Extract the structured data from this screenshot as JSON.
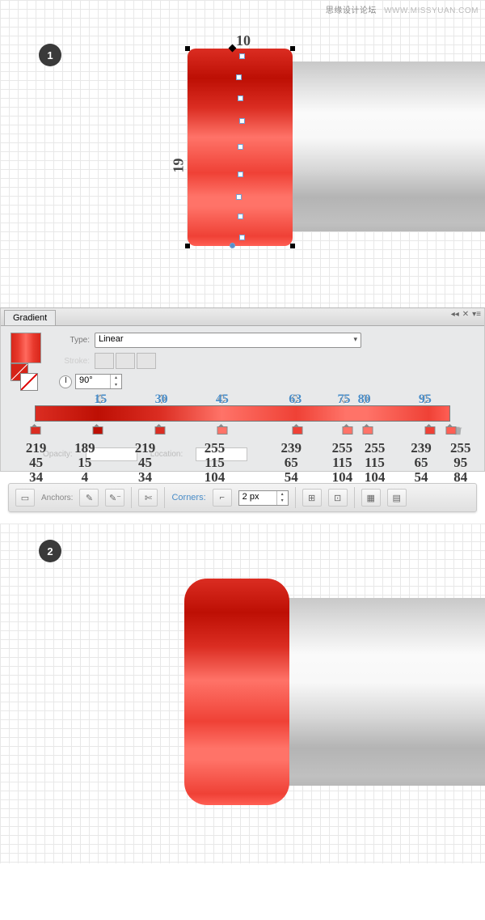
{
  "watermark": {
    "chinese": "思缘设计论坛",
    "url": "WWW.MISSYUAN.COM"
  },
  "step1": {
    "num": "1",
    "dim_w": "10",
    "dim_h": "19"
  },
  "step2": {
    "num": "2"
  },
  "panel": {
    "title": "Gradient",
    "type_label": "Type:",
    "type_value": "Linear",
    "stroke_label": "Stroke:",
    "angle_icon": "angle",
    "angle_value": "90°",
    "opacity_label": "Opacity:",
    "location_label": "Location:"
  },
  "gradient": {
    "positions": [
      "15",
      "30",
      "45",
      "63",
      "75",
      "80",
      "95"
    ],
    "stops": [
      {
        "pos": 0,
        "r": "219",
        "g": "45",
        "b": "34"
      },
      {
        "pos": 15,
        "r": "189",
        "g": "15",
        "b": "4"
      },
      {
        "pos": 30,
        "r": "219",
        "g": "45",
        "b": "34"
      },
      {
        "pos": 45,
        "r": "255",
        "g": "115",
        "b": "104"
      },
      {
        "pos": 63,
        "r": "239",
        "g": "65",
        "b": "54"
      },
      {
        "pos": 75,
        "r": "255",
        "g": "115",
        "b": "104"
      },
      {
        "pos": 80,
        "r": "255",
        "g": "115",
        "b": "104"
      },
      {
        "pos": 95,
        "r": "239",
        "g": "65",
        "b": "54"
      },
      {
        "pos": 100,
        "r": "255",
        "g": "95",
        "b": "84"
      }
    ]
  },
  "toolbar": {
    "anchors_label": "Anchors:",
    "corners_label": "Corners:",
    "corners_value": "2 px"
  }
}
